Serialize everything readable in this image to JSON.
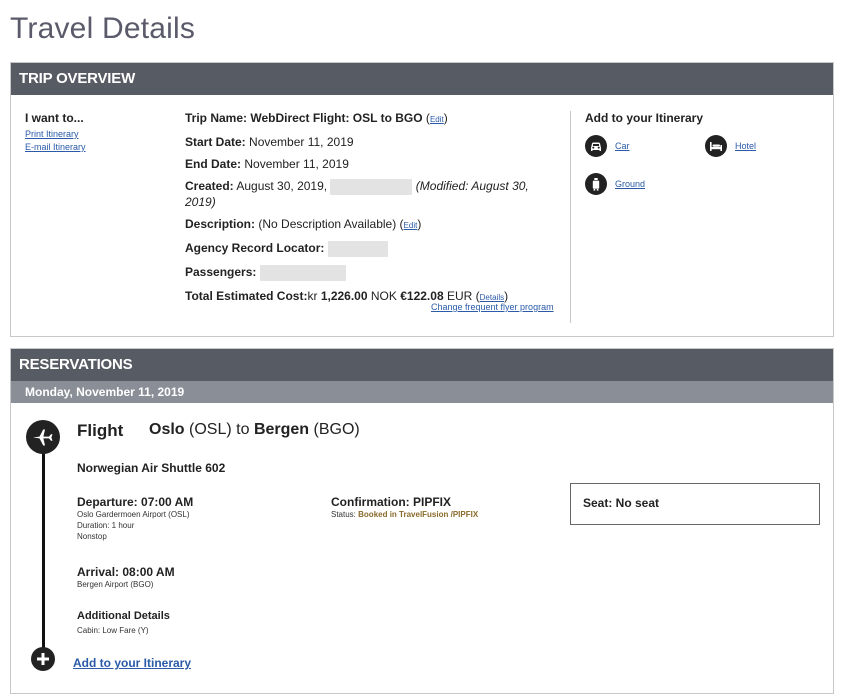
{
  "page": {
    "title": "Travel Details"
  },
  "trip_overview": {
    "header": "TRIP OVERVIEW",
    "i_want": {
      "title": "I want to...",
      "links": [
        "Print Itinerary",
        "E-mail Itinerary"
      ]
    },
    "details": {
      "trip_name_label": "Trip Name:",
      "trip_name_value": "WebDirect Flight: OSL to BGO",
      "edit": "Edit",
      "start_label": "Start Date:",
      "start_value": "November 11, 2019",
      "end_label": "End Date:",
      "end_value": "November 11, 2019",
      "created_label": "Created:",
      "created_value": "August 30, 2019,",
      "modified_line1": "(Modified: August 30,",
      "modified_line2": "2019)",
      "description_label": "Description:",
      "description_value": "(No Description Available)",
      "locator_label": "Agency Record Locator:",
      "passengers_label": "Passengers:",
      "cost_label": "Total Estimated Cost:",
      "cost_prefix": "kr",
      "cost_nok_amount": "1,226.00",
      "cost_nok_currency": "NOK",
      "cost_eur_amount": "€122.08",
      "cost_eur_currency": "EUR",
      "details_link": "Details",
      "change_ff_link": "Change frequent flyer program"
    },
    "add_itinerary": {
      "title": "Add to your Itinerary",
      "options": [
        {
          "label": "Car",
          "icon": "car-icon"
        },
        {
          "label": "Hotel",
          "icon": "hotel-icon"
        },
        {
          "label": "Ground",
          "icon": "ground-transport-icon"
        }
      ]
    }
  },
  "reservations": {
    "header": "RESERVATIONS",
    "date": "Monday, November 11, 2019",
    "flight": {
      "type": "Flight",
      "origin_city": "Oslo",
      "origin_code": "(OSL)",
      "to": "to",
      "dest_city": "Bergen",
      "dest_code": "(BGO)",
      "airline": "Norwegian Air Shuttle 602",
      "departure_head": "Departure: 07:00 AM",
      "departure_airport": "Oslo Gardermoen Airport (OSL)",
      "duration": "Duration: 1 hour",
      "stops": "Nonstop",
      "arrival_head": "Arrival: 08:00 AM",
      "arrival_airport": "Bergen Airport (BGO)",
      "additional_head": "Additional Details",
      "cabin": "Cabin: Low Fare (Y)",
      "confirmation_head": "Confirmation: PIPFIX",
      "status_label": "Status:",
      "status_value": "Booked in TravelFusion /PIPFIX",
      "seat": "Seat: No seat"
    },
    "add_link": "Add to your Itinerary"
  }
}
